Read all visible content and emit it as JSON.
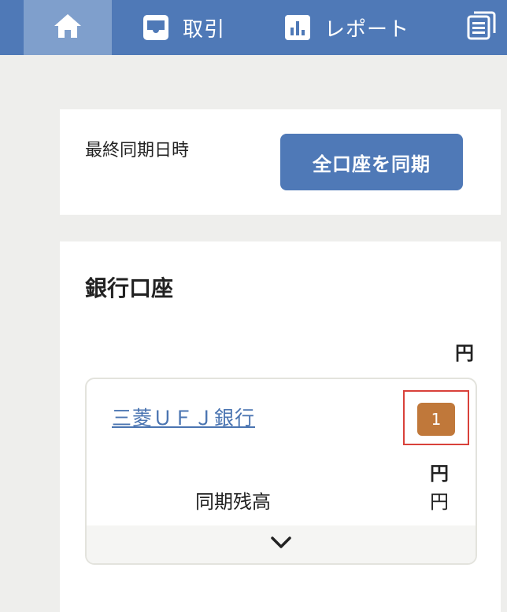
{
  "nav": {
    "home_icon": "home-icon",
    "transactions": {
      "label": "取引",
      "icon": "inbox-icon"
    },
    "reports": {
      "label": "レポート",
      "icon": "bar-chart-icon"
    },
    "more_icon": "document-list-icon"
  },
  "sync": {
    "label": "最終同期日時",
    "button": "全口座を同期"
  },
  "bank": {
    "title": "銀行口座",
    "total_unit": "円",
    "account": {
      "name": "三菱ＵＦＪ銀行",
      "badge": "1",
      "balance_unit": "円",
      "synced_label": "同期残高",
      "synced_unit": "円"
    }
  },
  "colors": {
    "nav_bg": "#4f79b7",
    "nav_active": "#7f9fcc",
    "button": "#4f79b7",
    "badge": "#c0783a",
    "highlight": "#d9413a",
    "link": "#4a74b1"
  }
}
